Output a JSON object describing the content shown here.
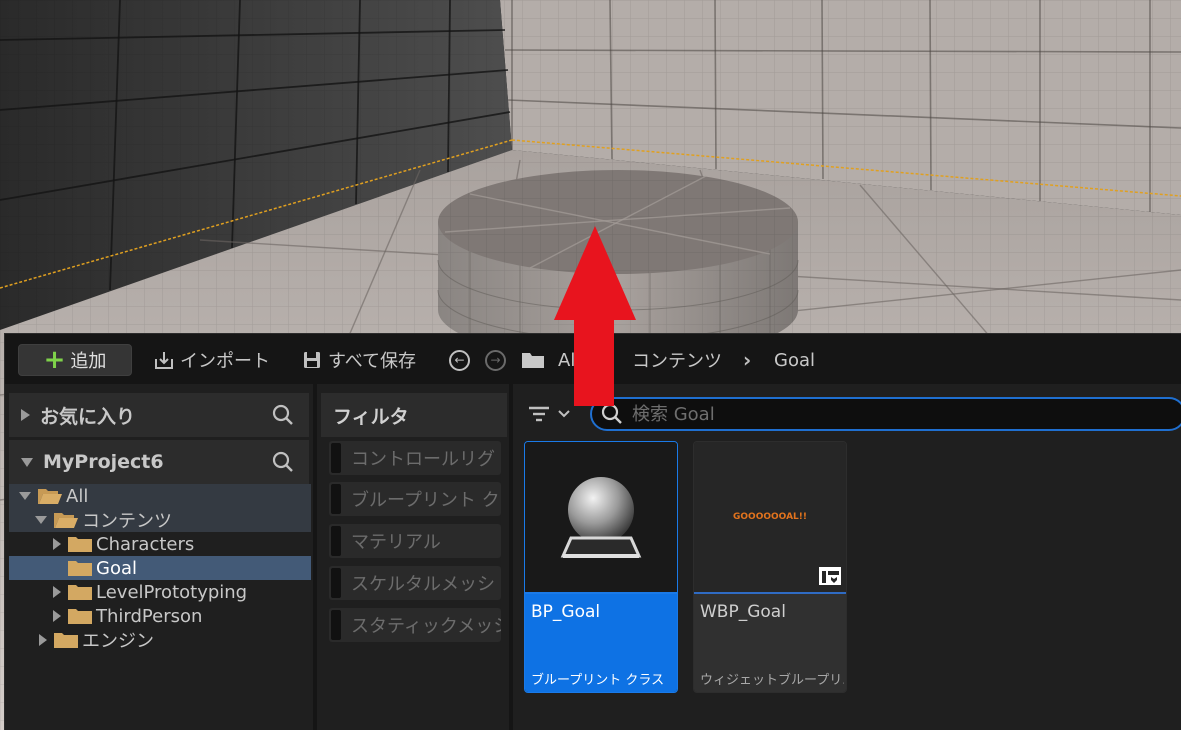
{
  "toolbar": {
    "add_label": "追加",
    "import_label": "インポート",
    "save_all_label": "すべて保存",
    "breadcrumb": [
      "All",
      "コンテンツ",
      "Goal"
    ]
  },
  "sidebar": {
    "favorites_label": "お気に入り",
    "project_label": "MyProject6",
    "tree": [
      {
        "label": "All"
      },
      {
        "label": "コンテンツ"
      },
      {
        "label": "Characters"
      },
      {
        "label": "Goal"
      },
      {
        "label": "LevelPrototyping"
      },
      {
        "label": "ThirdPerson"
      },
      {
        "label": "エンジン"
      }
    ]
  },
  "filters": {
    "title": "フィルタ",
    "items": [
      "コントロールリグ",
      "ブループリント ク",
      "マテリアル",
      "スケルタルメッシ",
      "スタティックメッシ"
    ]
  },
  "search": {
    "placeholder": "検索 Goal"
  },
  "assets": [
    {
      "name": "BP_Goal",
      "type": "ブループリント クラス",
      "selected": true
    },
    {
      "name": "WBP_Goal",
      "type": "ウィジェットブループリ...",
      "thumb_text": "GOOOOOOAL!!"
    }
  ],
  "colors": {
    "accent": "#0e72e4",
    "arrow": "#e8141e",
    "add_plus": "#7fd24a",
    "goal_text": "#e2731d"
  }
}
